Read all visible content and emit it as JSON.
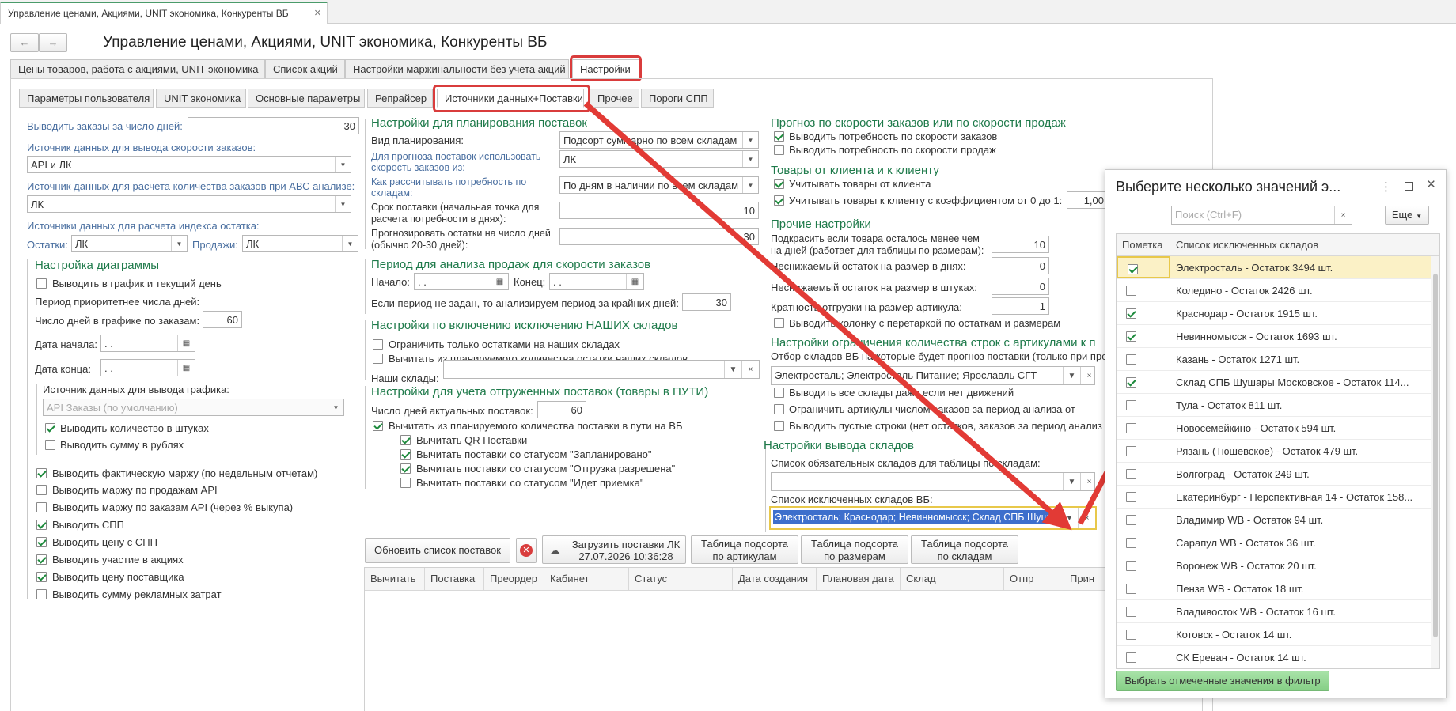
{
  "window_tab": {
    "title": "Управление ценами, Акциями, UNIT экономика, Конкуренты ВБ",
    "close": "×"
  },
  "nav": {
    "back": "←",
    "forward": "→"
  },
  "page_title": "Управление ценами, Акциями, UNIT экономика, Конкуренты ВБ",
  "main_tabs": [
    {
      "label": "Цены товаров, работа с акциями, UNIT экономика"
    },
    {
      "label": "Список акций"
    },
    {
      "label": "Настройки маржинальности без учета акций"
    },
    {
      "label": "Настройки"
    }
  ],
  "sub_tabs": [
    {
      "label": "Параметры пользователя"
    },
    {
      "label": "UNIT экономика"
    },
    {
      "label": "Основные параметры"
    },
    {
      "label": "Репрайсер"
    },
    {
      "label": "Источники данных+Поставки"
    },
    {
      "label": "Прочее"
    },
    {
      "label": "Пороги СПП"
    }
  ],
  "left": {
    "orders_days_label": "Выводить заказы за число дней:",
    "orders_days_value": "30",
    "speed_source_label": "Источник данных для вывода скорости заказов:",
    "speed_source_value": "API и ЛК",
    "abc_source_label": "Источник данных для расчета количества заказов при АВС анализе:",
    "abc_source_value": "ЛК",
    "index_source_label": "Источники данных для расчета индекса остатка:",
    "stock_label": "Остатки:",
    "stock_value": "ЛК",
    "sales_label": "Продажи:",
    "sales_value": "ЛК",
    "diagram_title": "Настройка диаграммы",
    "current_day_label": "Выводить в график и текущий день",
    "priority_label": "Период приоритетнее числа дней:",
    "days_chart_label": "Число дней в графике по заказам:",
    "days_chart_value": "60",
    "date_start_label": "Дата начала:",
    "date_start_value": " .  .",
    "date_end_label": "Дата конца:",
    "date_end_value": " .  .",
    "chart_source_label": "Источник данных для вывода графика:",
    "chart_source_value": "API Заказы (по умолчанию)",
    "qty_label": "Выводить количество в штуках",
    "sum_label": "Выводить сумму в рублях",
    "checks": [
      {
        "label": "Выводить фактическую маржу (по недельным отчетам)",
        "checked": true
      },
      {
        "label": "Выводить маржу по продажам API",
        "checked": false
      },
      {
        "label": "Выводить маржу по заказам API (через % выкупа)",
        "checked": false
      },
      {
        "label": "Выводить СПП",
        "checked": true
      },
      {
        "label": "Выводить цену с СПП",
        "checked": true
      },
      {
        "label": "Выводить участие в акциях",
        "checked": true
      },
      {
        "label": "Выводить цену поставщика",
        "checked": true
      },
      {
        "label": "Выводить сумму рекламных затрат",
        "checked": false
      }
    ]
  },
  "mid": {
    "plan_title": "Настройки для планирования поставок",
    "plan_kind_label": "Вид планирования:",
    "plan_kind_value": "Подсорт суммарно по всем складам",
    "forecast_label": "Для прогноза поставок использовать скорость заказов из:",
    "forecast_value": "ЛК",
    "calc_label": "Как рассчитывать потребность по складам:",
    "calc_value": "По дням в наличии по всем складам",
    "delivery_label": "Срок поставки (начальная точка для расчета потребности в днях):",
    "delivery_value": "10",
    "forecast_days_label": "Прогнозировать остатки на число дней (обычно 20-30 дней):",
    "forecast_days_value": "30",
    "sales_period_title": "Период для анализа продаж для скорости заказов",
    "start_label": "Начало:",
    "start_value": " .  .",
    "end_label": "Конец:",
    "end_value": " .  .",
    "no_period_label": "Если период не задан, то анализируем период за крайних дней:",
    "no_period_value": "30",
    "our_wh_title": "Настройки по включению исключению НАШИХ складов",
    "limit_our_label": "Ограничить только остатками на наших складах",
    "subtract_our_label": "Вычитать из планируемого количества остатки наших складов",
    "our_wh_label": "Наши склады:",
    "shipped_title": "Настройки для учета отгруженных поставок (товары в ПУТИ)",
    "actual_days_label": "Число дней актуальных поставок:",
    "actual_days_value": "60",
    "subtract_transit_label": "Вычитать из планируемого количества поставки в пути на ВБ",
    "sub_checks": [
      {
        "label": "Вычитать QR Поставки",
        "checked": true
      },
      {
        "label": "Вычитать поставки со статусом \"Запланировано\"",
        "checked": true
      },
      {
        "label": "Вычитать поставки со статусом \"Отгрузка разрешена\"",
        "checked": true
      },
      {
        "label": "Вычитать поставки со статусом \"Идет приемка\"",
        "checked": false
      }
    ]
  },
  "right": {
    "speed_title": "Прогноз по скорости заказов или по скорости продаж",
    "need_orders_label": "Выводить потребность по скорости заказов",
    "need_sales_label": "Выводить потребность по скорости продаж",
    "client_title": "Товары от клиента и к клиенту",
    "from_client_label": "Учитывать товары от клиента",
    "to_client_label": "Учитывать товары к клиенту с коэффициентом от 0 до 1:",
    "to_client_value": "1,00",
    "other_title": "Прочие настройки",
    "highlight_label": "Подкрасить если товара осталось менее чем на дней (работает для таблицы по размерам):",
    "highlight_value": "10",
    "min_days_label": "Неснижаемый остаток на размер в днях:",
    "min_days_value": "0",
    "min_pcs_label": "Неснижаемый остаток на размер в штуках:",
    "min_pcs_value": "0",
    "multiplicity_label": "Кратность отгрузки на размер артикула:",
    "multiplicity_value": "1",
    "overstock_label": "Выводить колонку с перетаркой по остаткам и размерам",
    "limit_rows_title": "Настройки ограничения количества строк с артикулами к п",
    "select_wh_label": "Отбор складов ВБ на которые будет прогноз поставки (только при про",
    "select_wh_value": "Электросталь; Электросталь Питание; Ярославль СГТ",
    "all_wh_label": "Выводить все склады даже если нет движений",
    "limit_art_label": "Ограничить артикулы числом заказов за период анализа от",
    "empty_rows_label": "Выводить пустые строки (нет остатков, заказов за период анализ",
    "output_title": "Настройки вывода складов",
    "required_label": "Список обязательных складов для таблицы по складам:",
    "required_value": "",
    "excluded_label": "Список исключенных складов ВБ:",
    "excluded_value": "Электросталь; Краснодар; Невинномысск; Склад СПБ Шуш"
  },
  "buttons": {
    "refresh": "Обновить список поставок",
    "load_lk": "Загрузить поставки ЛК",
    "load_lk_date": "27.07.2026 10:36:28",
    "by_article_1": "Таблица подсорта",
    "by_article_2": "по артикулам",
    "by_size_1": "Таблица подсорта",
    "by_size_2": "по размерам",
    "by_wh_1": "Таблица подсорта",
    "by_wh_2": "по складам"
  },
  "table_headers": [
    "Вычитать",
    "Поставка",
    "Преордер",
    "Кабинет",
    "Статус",
    "Дата создания",
    "Плановая дата",
    "Склад",
    "Отпр",
    "Прин"
  ],
  "dialog": {
    "title": "Выберите несколько значений э...",
    "search_placeholder": "Поиск (Ctrl+F)",
    "more_label": "Еще",
    "col_mark": "Пометка",
    "col_list": "Список исключенных складов",
    "submit": "Выбрать отмеченные значения в фильтр",
    "rows": [
      {
        "label": "Электросталь - Остаток 3494 шт.",
        "checked": true
      },
      {
        "label": "Коледино - Остаток 2426 шт.",
        "checked": false
      },
      {
        "label": "Краснодар - Остаток 1915 шт.",
        "checked": true
      },
      {
        "label": "Невинномысск - Остаток 1693 шт.",
        "checked": true
      },
      {
        "label": "Казань - Остаток 1271 шт.",
        "checked": false
      },
      {
        "label": "Склад СПБ Шушары Московское - Остаток 114...",
        "checked": true
      },
      {
        "label": "Тула - Остаток 811 шт.",
        "checked": false
      },
      {
        "label": "Новосемейкино - Остаток 594 шт.",
        "checked": false
      },
      {
        "label": "Рязань (Тюшевское) - Остаток 479 шт.",
        "checked": false
      },
      {
        "label": "Волгоград - Остаток 249 шт.",
        "checked": false
      },
      {
        "label": "Екатеринбург - Перспективная 14 - Остаток 158...",
        "checked": false
      },
      {
        "label": "Владимир WB - Остаток 94 шт.",
        "checked": false
      },
      {
        "label": "Сарапул WB - Остаток 36 шт.",
        "checked": false
      },
      {
        "label": "Воронеж WB - Остаток 20 шт.",
        "checked": false
      },
      {
        "label": "Пенза WB - Остаток 18 шт.",
        "checked": false
      },
      {
        "label": "Владивосток WB - Остаток 16 шт.",
        "checked": false
      },
      {
        "label": "Котовск - Остаток 14 шт.",
        "checked": false
      },
      {
        "label": "СК Ереван - Остаток 14 шт.",
        "checked": false
      }
    ]
  },
  "colors": {
    "accent_green": "#1e7a4a",
    "label_blue": "#4a6fa0",
    "highlight_red": "#d93c3c",
    "select_blue": "#3d6fcc",
    "button_green": "#8fd48f"
  }
}
